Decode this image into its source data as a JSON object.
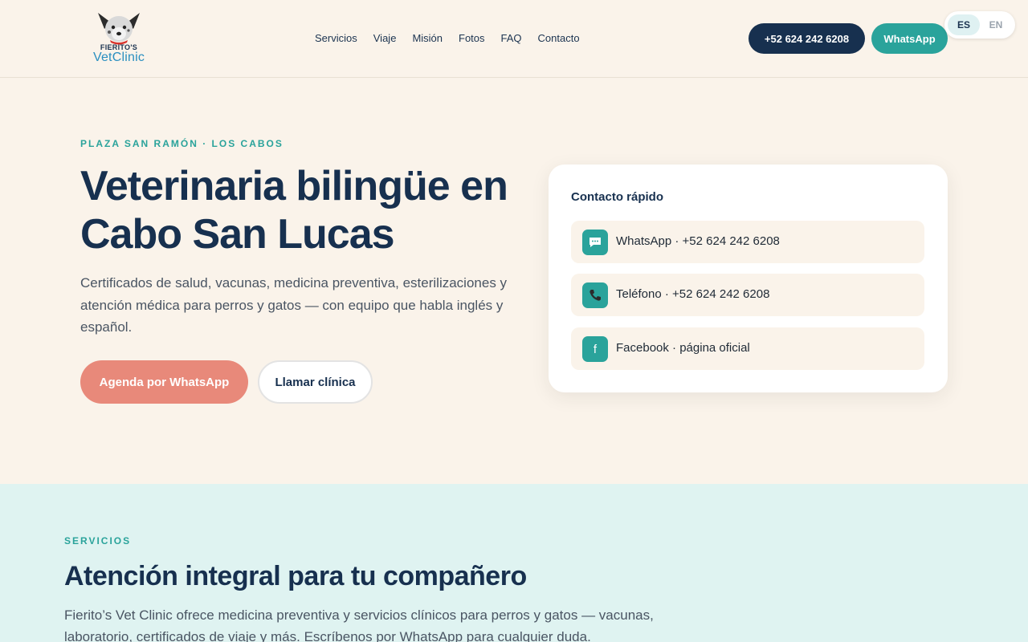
{
  "brand": {
    "logo_small": "FIERITO'S",
    "logo_big": "VetClinic"
  },
  "nav": {
    "items": [
      "Servicios",
      "Viaje",
      "Misión",
      "Fotos",
      "FAQ",
      "Contacto"
    ]
  },
  "header": {
    "phone_label": "+52 624 242 6208",
    "whatsapp_label": "WhatsApp",
    "lang_es": "ES",
    "lang_en": "EN"
  },
  "hero": {
    "eyebrow": "PLAZA SAN RAMÓN · LOS CABOS",
    "title": "Veterinaria bilingüe en Cabo San Lucas",
    "description": "Certificados de salud, vacunas, medicina preventiva, esterilizaciones y atención médica para perros y gatos — con equipo que habla inglés y español.",
    "cta_primary": "Agenda por WhatsApp",
    "cta_secondary": "Llamar clínica"
  },
  "quick_contact": {
    "title": "Contacto rápido",
    "items": [
      {
        "icon": "chat-icon",
        "label": "WhatsApp · +52 624 242 6208"
      },
      {
        "icon": "phone-icon",
        "label": "Teléfono · +52 624 242 6208"
      },
      {
        "icon": "facebook-icon",
        "label": "Facebook · página oficial"
      }
    ]
  },
  "services": {
    "eyebrow": "SERVICIOS",
    "title": "Atención integral para tu compañero",
    "description": "Fierito’s Vet Clinic ofrece medicina preventiva y servicios clínicos para perros y gatos — vacunas, laboratorio, certificados de viaje y más. Escríbenos por WhatsApp para cualquier duda."
  },
  "colors": {
    "navy": "#17304f",
    "teal": "#2aa39b",
    "coral": "#e8897a",
    "cream": "#faf3ea",
    "mint": "#dff3f1"
  }
}
